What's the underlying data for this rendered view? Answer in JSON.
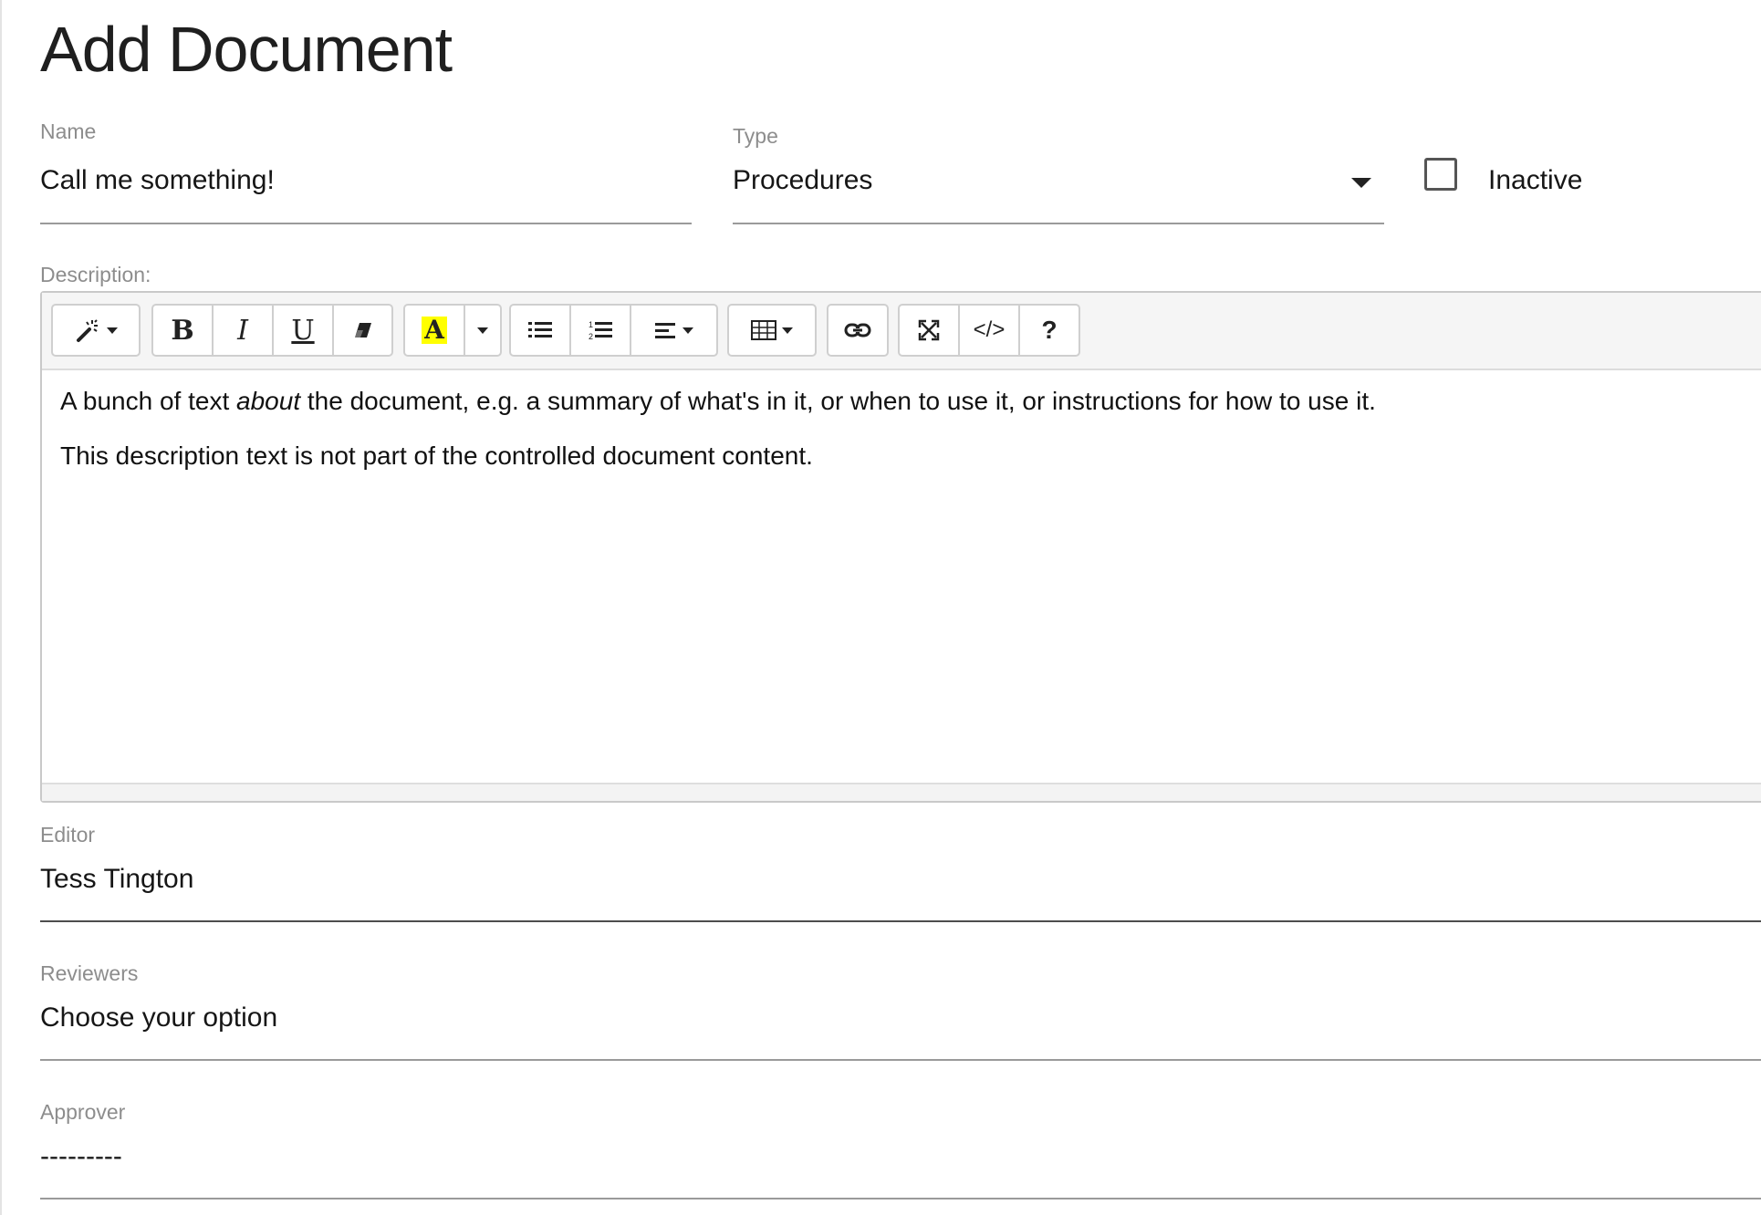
{
  "page": {
    "title": "Add Document"
  },
  "form": {
    "name": {
      "label": "Name",
      "value": "Call me something!"
    },
    "type": {
      "label": "Type",
      "value": "Procedures"
    },
    "inactive": {
      "label": "Inactive",
      "checked": false
    },
    "description": {
      "label": "Description:",
      "paragraph1": {
        "before": "A bunch of text ",
        "emphasis": "about",
        "after": " the document, e.g. a summary of what's in it, or when to use it, or instructions for how to use it."
      },
      "paragraph2": "This description text is not part of the controlled document content."
    },
    "editor": {
      "label": "Editor",
      "value": "Tess Tington"
    },
    "reviewers": {
      "label": "Reviewers",
      "value": "Choose your option"
    },
    "approver": {
      "label": "Approver",
      "value": "---------"
    }
  },
  "toolbar": {
    "bold": "B",
    "italic": "I",
    "underline": "U",
    "font_color": "A",
    "code_view": "</>",
    "help": "?",
    "icons": [
      "magic-wand-icon",
      "eraser-icon",
      "unordered-list-icon",
      "ordered-list-icon",
      "align-left-icon",
      "table-icon",
      "link-icon",
      "fullscreen-icon"
    ],
    "highlight_color": "#ffff00"
  }
}
